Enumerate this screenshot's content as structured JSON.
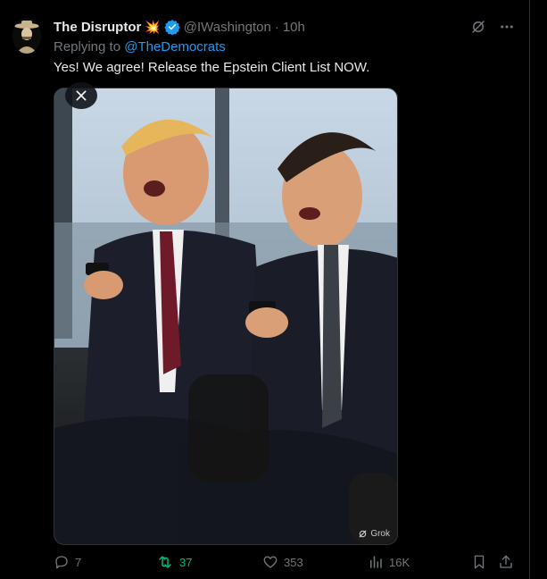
{
  "tweet": {
    "display_name": "The Disruptor",
    "name_emoji": "💥",
    "handle": "@IWashington",
    "separator": "·",
    "time": "10h",
    "replying_prefix": "Replying to",
    "replying_to": "@TheDemocrats",
    "text": "Yes! We agree! Release the Epstein Client List NOW.",
    "image_watermark": "Grok"
  },
  "actions": {
    "replies": "7",
    "reposts": "37",
    "likes": "353",
    "views": "16K"
  },
  "colors": {
    "background": "#000000",
    "text": "#e7e9ea",
    "muted": "#71767b",
    "link": "#1d9bf0",
    "retweet_active": "#00ba7c",
    "verified": "#1d9bf0"
  },
  "icons": [
    "avatar",
    "verified-badge-icon",
    "grok-icon",
    "more-icon",
    "close-icon",
    "reply-icon",
    "retweet-icon",
    "like-icon",
    "views-icon",
    "bookmark-icon",
    "share-icon"
  ]
}
